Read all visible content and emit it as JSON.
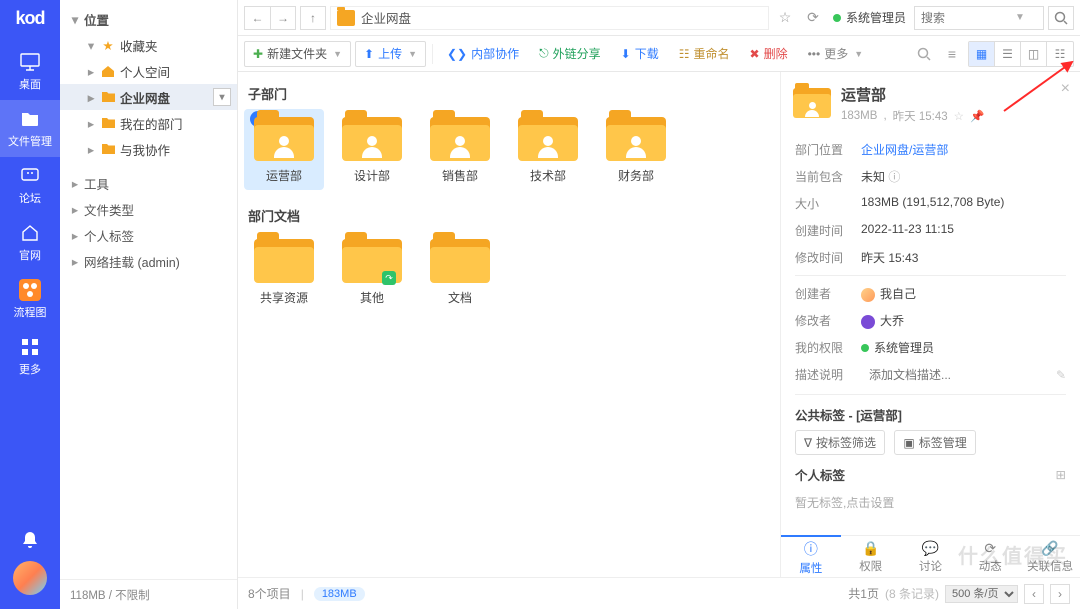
{
  "logo": "kod",
  "rail": {
    "items": [
      {
        "label": "桌面",
        "icon": "desktop"
      },
      {
        "label": "文件管理",
        "icon": "folder",
        "active": true
      },
      {
        "label": "论坛",
        "icon": "chat"
      },
      {
        "label": "官网",
        "icon": "home"
      },
      {
        "label": "流程图",
        "icon": "flow",
        "accent": "#ff8a2b"
      },
      {
        "label": "更多",
        "icon": "grid"
      }
    ]
  },
  "tree": {
    "header": "位置",
    "groups": [
      {
        "name": "收藏夹",
        "icon": "star",
        "color": "#f5a623",
        "open": true,
        "items": []
      },
      {
        "name": "个人空间",
        "icon": "home",
        "color": "#f5a623"
      },
      {
        "name": "企业网盘",
        "icon": "folder",
        "color": "#f5a623",
        "selected": true,
        "open": true
      },
      {
        "name": "我在的部门",
        "icon": "folder",
        "color": "#f5a623"
      },
      {
        "name": "与我协作",
        "icon": "folder",
        "color": "#f5a623"
      }
    ],
    "sections": [
      {
        "name": "工具"
      },
      {
        "name": "文件类型"
      },
      {
        "name": "个人标签"
      },
      {
        "name": "网络挂载 (admin)"
      }
    ],
    "footer": "118MB / 不限制"
  },
  "addr": {
    "path": "企业网盘",
    "user": "系统管理员",
    "search_placeholder": "搜索"
  },
  "toolbar": {
    "new_folder": "新建文件夹",
    "upload": "上传",
    "internal": "内部协作",
    "external": "外链分享",
    "download": "下载",
    "rename": "重命名",
    "delete": "删除",
    "more": "更多"
  },
  "sections": [
    {
      "title": "子部门",
      "items": [
        {
          "label": "运营部",
          "type": "person",
          "selected": true
        },
        {
          "label": "设计部",
          "type": "person"
        },
        {
          "label": "销售部",
          "type": "person"
        },
        {
          "label": "技术部",
          "type": "person"
        },
        {
          "label": "财务部",
          "type": "person"
        }
      ]
    },
    {
      "title": "部门文档",
      "items": [
        {
          "label": "共享资源",
          "type": "folder"
        },
        {
          "label": "其他",
          "type": "folder",
          "shared": true
        },
        {
          "label": "文档",
          "type": "folder"
        }
      ]
    }
  ],
  "footer": {
    "count": "8个项目",
    "size": "183MB",
    "pages": "共1页",
    "records": "(8 条记录)",
    "per_page": "500 条/页"
  },
  "details": {
    "title": "运营部",
    "sub_size": "183MB",
    "sub_time": "昨天 15:43",
    "rows": {
      "loc_k": "部门位置",
      "loc_v": "企业网盘/运营部",
      "cur_k": "当前包含",
      "cur_v": "未知",
      "size_k": "大小",
      "size_v": "183MB (191,512,708 Byte)",
      "ctime_k": "创建时间",
      "ctime_v": "2022-11-23 11:15",
      "mtime_k": "修改时间",
      "mtime_v": "昨天 15:43",
      "creator_k": "创建者",
      "creator_v": "我自己",
      "editor_k": "修改者",
      "editor_v": "大乔",
      "perm_k": "我的权限",
      "perm_v": "系统管理员",
      "desc_k": "描述说明",
      "desc_ph": "添加文档描述..."
    },
    "pub_tag_head": "公共标签 - [运营部]",
    "filter_tag": "按标签筛选",
    "manage_tag": "标签管理",
    "priv_tag_head": "个人标签",
    "priv_hint": "暂无标签,点击设置",
    "tabs": [
      {
        "label": "属性",
        "active": true
      },
      {
        "label": "权限"
      },
      {
        "label": "讨论"
      },
      {
        "label": "动态"
      },
      {
        "label": "关联信息"
      }
    ]
  },
  "watermark": "什么值得买"
}
